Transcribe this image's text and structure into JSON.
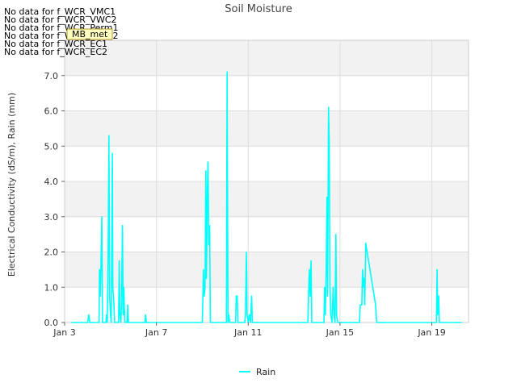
{
  "chart_data": {
    "type": "line",
    "title": "Soil Moisture",
    "ylabel": "Electrical Conductivity (dS/m), Rain (mm)",
    "xlabel": "",
    "xlim": [
      "2024-01-03",
      "2024-01-20.6"
    ],
    "ylim": [
      0,
      8
    ],
    "x_ticks": [
      {
        "value": "2024-01-03",
        "label": "Jan 3"
      },
      {
        "value": "2024-01-07",
        "label": "Jan 7"
      },
      {
        "value": "2024-01-11",
        "label": "Jan 11"
      },
      {
        "value": "2024-01-15",
        "label": "Jan 15"
      },
      {
        "value": "2024-01-19",
        "label": "Jan 19"
      }
    ],
    "y_ticks": [
      {
        "value": 0,
        "label": "0.0"
      },
      {
        "value": 1,
        "label": "1.0"
      },
      {
        "value": 2,
        "label": "2.0"
      },
      {
        "value": 3,
        "label": "3.0"
      },
      {
        "value": 4,
        "label": "4.0"
      },
      {
        "value": 5,
        "label": "5.0"
      },
      {
        "value": 6,
        "label": "6.0"
      },
      {
        "value": 7,
        "label": "7.0"
      }
    ],
    "grid": true,
    "banded_background": true,
    "legend_position": "bottom-center",
    "no_data_messages": [
      "No data for f_WCR_VMC1",
      "No data for f_WCR_VWC2",
      "No data for f_WCR_Perm1",
      "No data for f_WCR_Perm2",
      "No data for f_WCR_EC1",
      "No data for f_WCR_EC2"
    ],
    "overlay_tag": "MB_met",
    "series": [
      {
        "name": "Rain",
        "color": "#00ffff",
        "points": [
          [
            "2024-01-03.30",
            0
          ],
          [
            "2024-01-04.00",
            0
          ],
          [
            "2024-01-04.05",
            0.22
          ],
          [
            "2024-01-04.10",
            0
          ],
          [
            "2024-01-04.50",
            0
          ],
          [
            "2024-01-04.52",
            1.5
          ],
          [
            "2024-01-04.55",
            0.75
          ],
          [
            "2024-01-04.58",
            1.5
          ],
          [
            "2024-01-04.62",
            3.0
          ],
          [
            "2024-01-04.65",
            0
          ],
          [
            "2024-01-04.80",
            0
          ],
          [
            "2024-01-04.83",
            0.22
          ],
          [
            "2024-01-04.86",
            0
          ],
          [
            "2024-01-04.90",
            2.2
          ],
          [
            "2024-01-04.93",
            5.3
          ],
          [
            "2024-01-04.96",
            0.75
          ],
          [
            "2024-01-05.00",
            0.22
          ],
          [
            "2024-01-05.03",
            0
          ],
          [
            "2024-01-05.08",
            4.8
          ],
          [
            "2024-01-05.10",
            1.0
          ],
          [
            "2024-01-05.15",
            0.5
          ],
          [
            "2024-01-05.18",
            0
          ],
          [
            "2024-01-05.35",
            0
          ],
          [
            "2024-01-05.38",
            1.75
          ],
          [
            "2024-01-05.41",
            0.22
          ],
          [
            "2024-01-05.45",
            0
          ],
          [
            "2024-01-05.48",
            0.5
          ],
          [
            "2024-01-05.52",
            2.75
          ],
          [
            "2024-01-05.55",
            0.22
          ],
          [
            "2024-01-05.58",
            1.0
          ],
          [
            "2024-01-05.62",
            0
          ],
          [
            "2024-01-05.72",
            0
          ],
          [
            "2024-01-05.75",
            0.5
          ],
          [
            "2024-01-05.78",
            0
          ],
          [
            "2024-01-06.50",
            0
          ],
          [
            "2024-01-06.53",
            0.22
          ],
          [
            "2024-01-06.56",
            0
          ],
          [
            "2024-01-09.00",
            0
          ],
          [
            "2024-01-09.05",
            1.5
          ],
          [
            "2024-01-09.08",
            0.75
          ],
          [
            "2024-01-09.12",
            1.0
          ],
          [
            "2024-01-09.15",
            4.3
          ],
          [
            "2024-01-09.18",
            1.25
          ],
          [
            "2024-01-09.22",
            3.75
          ],
          [
            "2024-01-09.25",
            4.55
          ],
          [
            "2024-01-09.28",
            2.2
          ],
          [
            "2024-01-09.32",
            2.75
          ],
          [
            "2024-01-09.35",
            0
          ],
          [
            "2024-01-10.05",
            0
          ],
          [
            "2024-01-10.08",
            7.1
          ],
          [
            "2024-01-10.12",
            0
          ],
          [
            "2024-01-10.15",
            0.22
          ],
          [
            "2024-01-10.20",
            0
          ],
          [
            "2024-01-10.45",
            0
          ],
          [
            "2024-01-10.48",
            0.75
          ],
          [
            "2024-01-10.52",
            0.75
          ],
          [
            "2024-01-10.55",
            0
          ],
          [
            "2024-01-10.85",
            0
          ],
          [
            "2024-01-10.88",
            0.22
          ],
          [
            "2024-01-10.92",
            2.0
          ],
          [
            "2024-01-10.95",
            0.22
          ],
          [
            "2024-01-11.00",
            0
          ],
          [
            "2024-01-11.05",
            0.22
          ],
          [
            "2024-01-11.10",
            0
          ],
          [
            "2024-01-11.15",
            0.75
          ],
          [
            "2024-01-11.18",
            0
          ],
          [
            "2024-01-13.60",
            0
          ],
          [
            "2024-01-13.63",
            0.75
          ],
          [
            "2024-01-13.66",
            1.5
          ],
          [
            "2024-01-13.70",
            0.75
          ],
          [
            "2024-01-13.74",
            1.75
          ],
          [
            "2024-01-13.77",
            0
          ],
          [
            "2024-01-14.30",
            0
          ],
          [
            "2024-01-14.33",
            1.0
          ],
          [
            "2024-01-14.36",
            0.22
          ],
          [
            "2024-01-14.40",
            1.5
          ],
          [
            "2024-01-14.43",
            3.55
          ],
          [
            "2024-01-14.46",
            0.75
          ],
          [
            "2024-01-14.50",
            6.1
          ],
          [
            "2024-01-14.53",
            5.05
          ],
          [
            "2024-01-14.56",
            1.0
          ],
          [
            "2024-01-14.60",
            0.22
          ],
          [
            "2024-01-14.65",
            0
          ],
          [
            "2024-01-14.70",
            1.0
          ],
          [
            "2024-01-14.74",
            0.22
          ],
          [
            "2024-01-14.78",
            0
          ],
          [
            "2024-01-14.82",
            2.5
          ],
          [
            "2024-01-14.85",
            0.22
          ],
          [
            "2024-01-14.90",
            0
          ],
          [
            "2024-01-15.85",
            0
          ],
          [
            "2024-01-15.88",
            0.5
          ],
          [
            "2024-01-15.95",
            0.5
          ],
          [
            "2024-01-15.98",
            1.5
          ],
          [
            "2024-01-16.02",
            1.0
          ],
          [
            "2024-01-16.05",
            1.25
          ],
          [
            "2024-01-16.08",
            0.5
          ],
          [
            "2024-01-16.12",
            2.25
          ],
          [
            "2024-01-16.55",
            0.5
          ],
          [
            "2024-01-16.60",
            0
          ],
          [
            "2024-01-19.20",
            0
          ],
          [
            "2024-01-19.23",
            1.5
          ],
          [
            "2024-01-19.26",
            0.22
          ],
          [
            "2024-01-19.30",
            0.75
          ],
          [
            "2024-01-19.33",
            0
          ],
          [
            "2024-01-20.30",
            0
          ]
        ]
      }
    ]
  }
}
